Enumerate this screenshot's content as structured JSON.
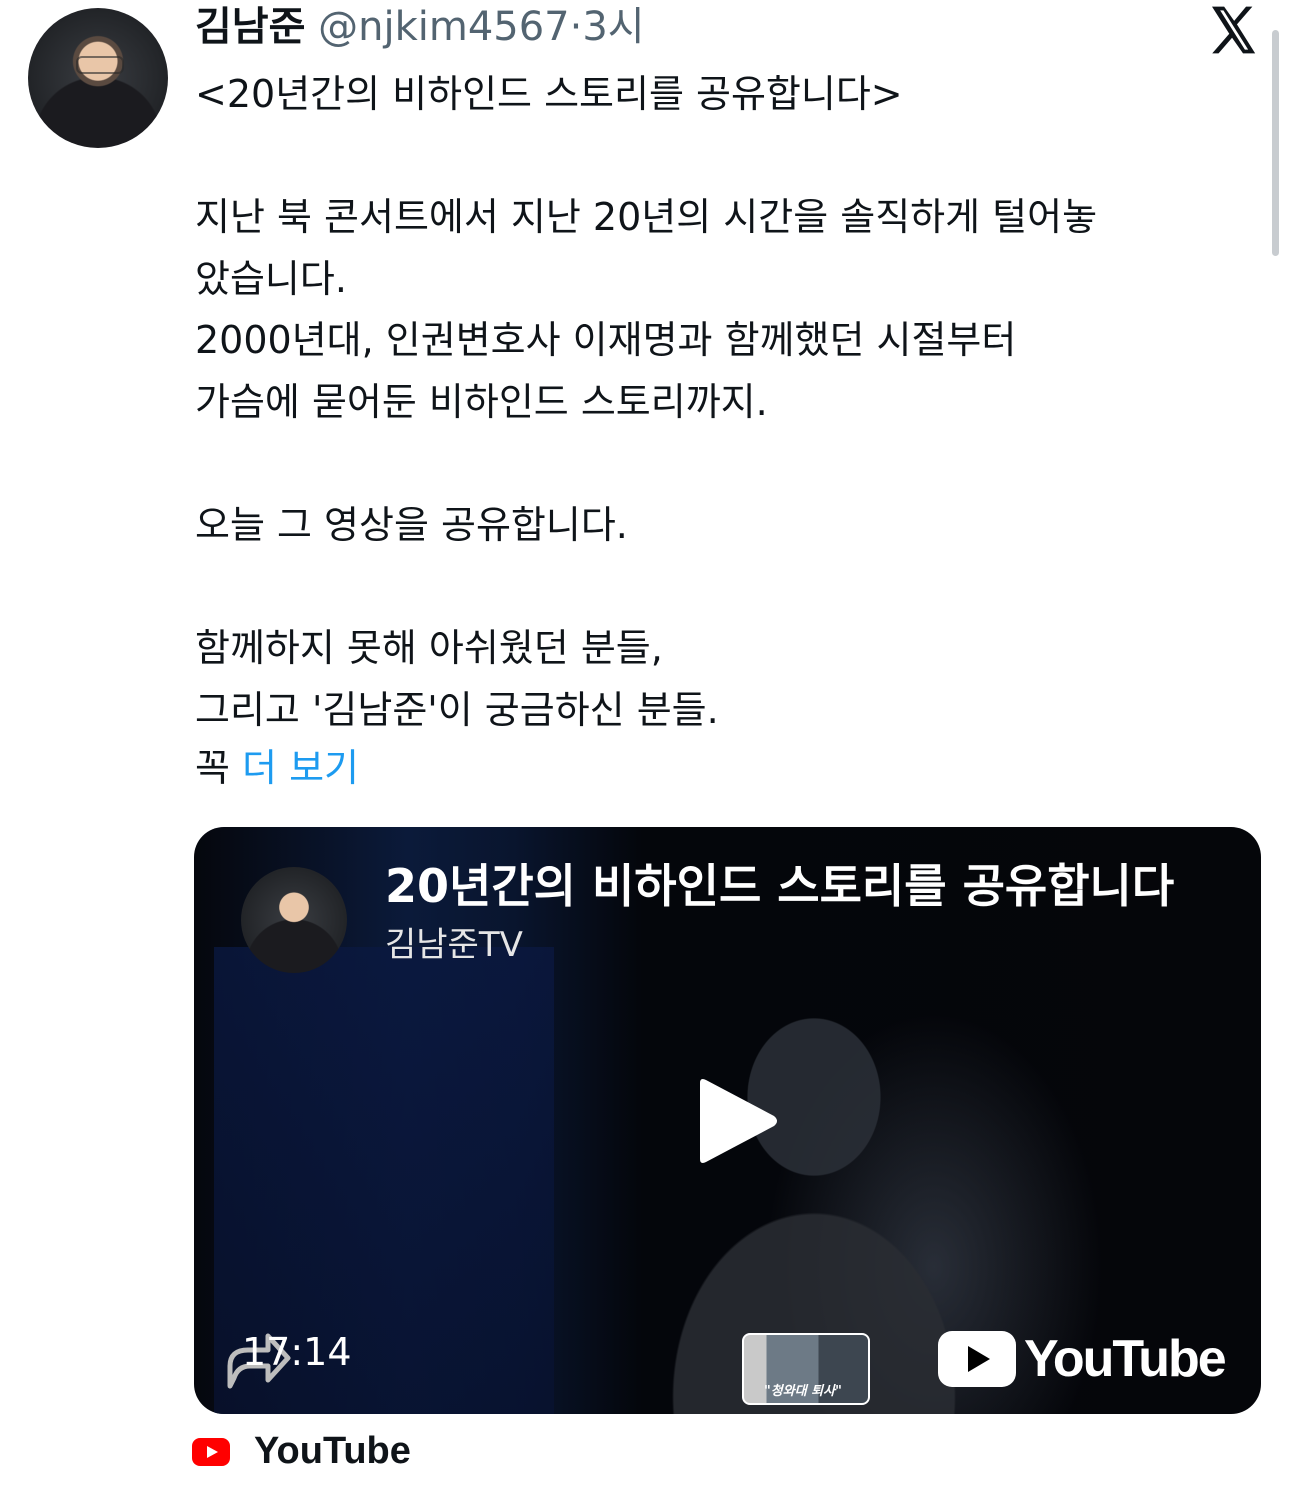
{
  "tweet": {
    "author_name": "김남준",
    "handle": "@njkim4567",
    "separator": "·",
    "time": "3시",
    "text": "<20년간의 비하인드 스토리를 공유합니다>\n\n지난 북 콘서트에서 지난 20년의 시간을 솔직하게 털어놓\n았습니다.\n2000년대, 인권변호사 이재명과 함께했던 시절부터\n가슴에 묻어둔 비하인드 스토리까지.\n\n오늘 그 영상을 공유합니다.\n\n함께하지 못해 아쉬웠던 분들,\n그리고 '김남준'이 궁금하신 분들.",
    "more_prefix": "꼭 ",
    "more_link": "더 보기"
  },
  "video": {
    "title": "20년간의 비하인드 스토리를 공유합니다",
    "channel": "김남준TV",
    "duration": "17:14",
    "thumbnail_caption": "\"청와대 퇴사\"",
    "brand": "YouTube"
  },
  "source": {
    "label": "YouTube"
  },
  "icons": {
    "close": "x-logo-icon",
    "play": "play-icon",
    "share": "share-arrow-icon",
    "youtube": "youtube-icon"
  },
  "colors": {
    "link": "#1d9bf0",
    "handle": "#536471",
    "youtube_red": "#ff0000"
  }
}
